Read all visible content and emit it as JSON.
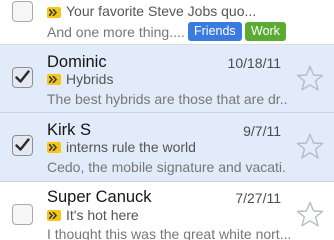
{
  "colors": {
    "selected_row_bg": "#e2ebf9",
    "important_marker": "#f5c518",
    "label_friends": "#3a7be0",
    "label_work": "#5aaa34"
  },
  "messages": [
    {
      "sender": "",
      "date": "",
      "subject": "Your favorite Steve Jobs quo...",
      "snippet": "And one more thing....",
      "selected": false,
      "starred": false,
      "labels": [
        "Friends",
        "Work"
      ]
    },
    {
      "sender": "Dominic",
      "date": "10/18/11",
      "subject": "Hybrids",
      "snippet": "The best hybrids are those that are dr...",
      "selected": true,
      "starred": false
    },
    {
      "sender": "Kirk S",
      "date": "9/7/11",
      "subject": "interns rule the world",
      "snippet": "Cedo, the mobile signature and vacati...",
      "selected": true,
      "starred": false
    },
    {
      "sender": "Super Canuck",
      "date": "7/27/11",
      "subject": "It's hot here",
      "snippet": "I thought this was the great white nort...",
      "selected": false,
      "starred": false
    }
  ],
  "icons": {
    "checkbox": "checkbox-icon",
    "star": "star-outline-icon",
    "important": "important-marker-icon"
  }
}
